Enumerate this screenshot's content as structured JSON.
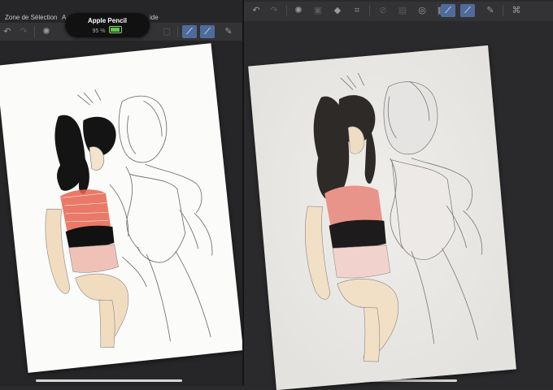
{
  "menu": {
    "selection_label": "Zone de Sélection",
    "item_partial": "A",
    "help_partial": "ide"
  },
  "pencil_status": {
    "name": "Apple Pencil",
    "battery_text": "95 %",
    "battery_color": "#5dc54a"
  },
  "toolbar_icons": {
    "undo": "undo-icon",
    "redo": "redo-icon",
    "selection": "selection-icon",
    "fill": "fill-icon",
    "transform": "transform-icon",
    "brush_active": "brush-icon",
    "eraser": "eraser-icon"
  },
  "colors": {
    "accent": "#4f6b9c",
    "background": "#2b2b2d"
  }
}
